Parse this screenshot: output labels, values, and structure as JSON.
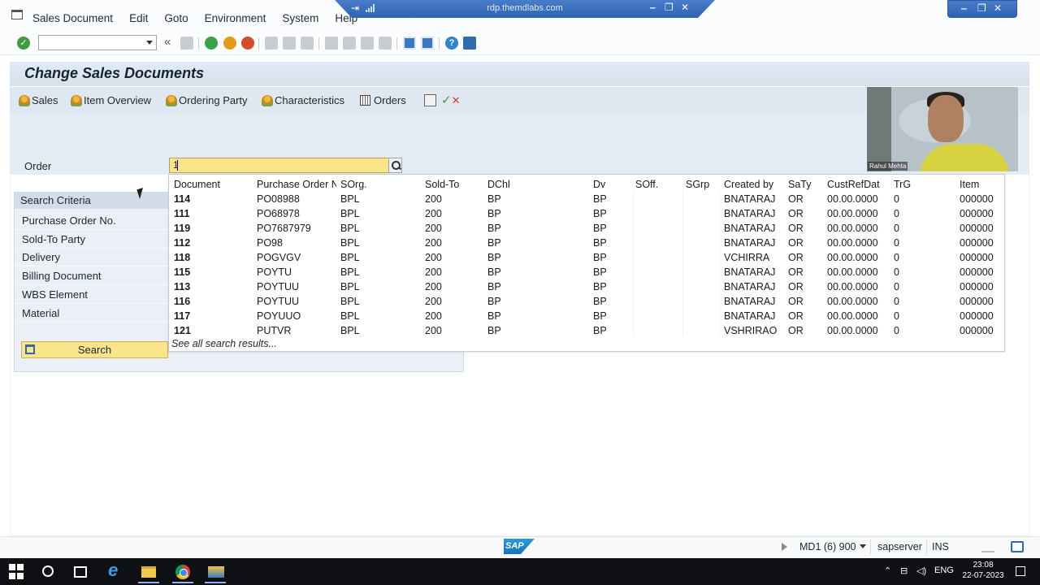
{
  "menu": [
    "Sales Document",
    "Edit",
    "Goto",
    "Environment",
    "System",
    "Help"
  ],
  "rdp": {
    "title": "rdp.themdlabs.com"
  },
  "screen_title": "Change Sales Documents",
  "app_toolbar": [
    "Sales",
    "Item Overview",
    "Ordering Party",
    "Characteristics",
    "Orders"
  ],
  "order": {
    "label": "Order",
    "value": "1"
  },
  "search_criteria": {
    "heading": "Search Criteria",
    "items": [
      "Purchase Order No.",
      "Sold-To Party",
      "Delivery",
      "Billing Document",
      "WBS Element",
      "Material"
    ],
    "button": "Search"
  },
  "dropdown": {
    "columns": [
      "Document",
      "Purchase Order N",
      "SOrg.",
      "Sold-To",
      "DChl",
      "Dv",
      "SOff.",
      "SGrp",
      "Created by",
      "SaTy",
      "CustRefDat",
      "TrG",
      "Item"
    ],
    "rows": [
      [
        "114",
        "PO08988",
        "BPL",
        "200",
        "BP",
        "BP",
        "",
        "",
        "BNATARAJ",
        "OR",
        "00.00.0000",
        "0",
        "000000"
      ],
      [
        "111",
        "PO68978",
        "BPL",
        "200",
        "BP",
        "BP",
        "",
        "",
        "BNATARAJ",
        "OR",
        "00.00.0000",
        "0",
        "000000"
      ],
      [
        "119",
        "PO7687979",
        "BPL",
        "200",
        "BP",
        "BP",
        "",
        "",
        "BNATARAJ",
        "OR",
        "00.00.0000",
        "0",
        "000000"
      ],
      [
        "112",
        "PO98",
        "BPL",
        "200",
        "BP",
        "BP",
        "",
        "",
        "BNATARAJ",
        "OR",
        "00.00.0000",
        "0",
        "000000"
      ],
      [
        "118",
        "POGVGV",
        "BPL",
        "200",
        "BP",
        "BP",
        "",
        "",
        "VCHIRRA",
        "OR",
        "00.00.0000",
        "0",
        "000000"
      ],
      [
        "115",
        "POYTU",
        "BPL",
        "200",
        "BP",
        "BP",
        "",
        "",
        "BNATARAJ",
        "OR",
        "00.00.0000",
        "0",
        "000000"
      ],
      [
        "113",
        "POYTUU",
        "BPL",
        "200",
        "BP",
        "BP",
        "",
        "",
        "BNATARAJ",
        "OR",
        "00.00.0000",
        "0",
        "000000"
      ],
      [
        "116",
        "POYTUU",
        "BPL",
        "200",
        "BP",
        "BP",
        "",
        "",
        "BNATARAJ",
        "OR",
        "00.00.0000",
        "0",
        "000000"
      ],
      [
        "117",
        "POYUUO",
        "BPL",
        "200",
        "BP",
        "BP",
        "",
        "",
        "BNATARAJ",
        "OR",
        "00.00.0000",
        "0",
        "000000"
      ],
      [
        "121",
        "PUTVR",
        "BPL",
        "200",
        "BP",
        "BP",
        "",
        "",
        "VSHRIRAO",
        "OR",
        "00.00.0000",
        "0",
        "000000"
      ]
    ],
    "footer": "See all search results..."
  },
  "webcam": {
    "name": "Rahul Mehta"
  },
  "statusbar": {
    "system": "MD1 (6) 900",
    "server": "sapserver",
    "mode": "INS",
    "logo": "SAP"
  },
  "taskbar": {
    "language": "ENG",
    "time": "23:08",
    "date": "22-07-2023"
  },
  "colors": {
    "input_highlight": "#fbe58a",
    "title_bar": "#dce6f0"
  }
}
